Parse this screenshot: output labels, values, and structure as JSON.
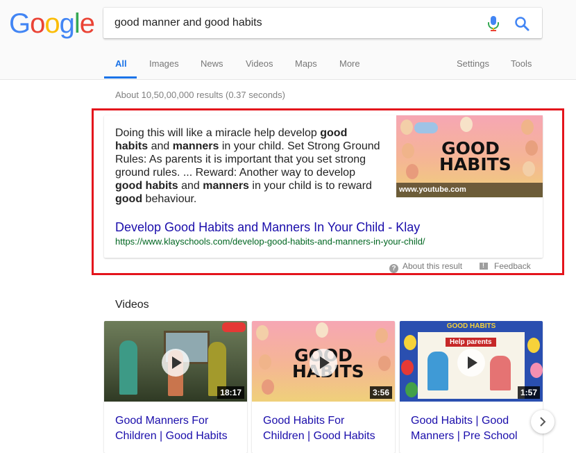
{
  "logo": {
    "letters": [
      "G",
      "o",
      "o",
      "g",
      "l",
      "e"
    ],
    "colors": [
      "#4285f4",
      "#ea4335",
      "#fbbc05",
      "#4285f4",
      "#34a853",
      "#ea4335"
    ]
  },
  "search": {
    "query": "good manner and good habits"
  },
  "tabs": [
    {
      "label": "All",
      "active": true
    },
    {
      "label": "Images"
    },
    {
      "label": "News"
    },
    {
      "label": "Videos"
    },
    {
      "label": "Maps"
    },
    {
      "label": "More"
    },
    {
      "label": "Settings"
    },
    {
      "label": "Tools"
    }
  ],
  "stats": "About 10,50,00,000 results (0.37 seconds)",
  "featured": {
    "snippet": [
      {
        "text": "Doing this will like a miracle help develop ",
        "bold": false
      },
      {
        "text": "good habits",
        "bold": true
      },
      {
        "text": " and ",
        "bold": false
      },
      {
        "text": "manners",
        "bold": true
      },
      {
        "text": " in your child. Set Strong Ground Rules: As parents it is important that you set strong ground rules. ... Reward: Another way to develop ",
        "bold": false
      },
      {
        "text": "good habits",
        "bold": true
      },
      {
        "text": " and ",
        "bold": false
      },
      {
        "text": "manners",
        "bold": true
      },
      {
        "text": " in your child is to reward ",
        "bold": false
      },
      {
        "text": "good",
        "bold": true
      },
      {
        "text": " behaviour.",
        "bold": false
      }
    ],
    "thumbnail_text": "GOOD HABITS",
    "thumbnail_source": "www.youtube.com",
    "title": "Develop Good Habits and Manners In Your Child - Klay",
    "url": "https://www.klayschools.com/develop-good-habits-and-manners-in-your-child/",
    "about_label": "About this result",
    "feedback_label": "Feedback"
  },
  "videos": {
    "heading": "Videos",
    "items": [
      {
        "title": "Good Manners For Children | Good Habits",
        "duration": "18:17"
      },
      {
        "title": "Good Habits For Children | Good Habits",
        "duration": "3:56",
        "thumb_text": "GOOD HABITS"
      },
      {
        "title": "Good Habits | Good Manners | Pre School",
        "duration": "1:57",
        "thumb_text": "GOOD HABITS",
        "thumb_caption": "Help parents"
      }
    ]
  },
  "colors": {
    "link": "#1a0dab",
    "url": "#006621",
    "accent": "#1a73e8",
    "highlight": "#e4141c"
  }
}
